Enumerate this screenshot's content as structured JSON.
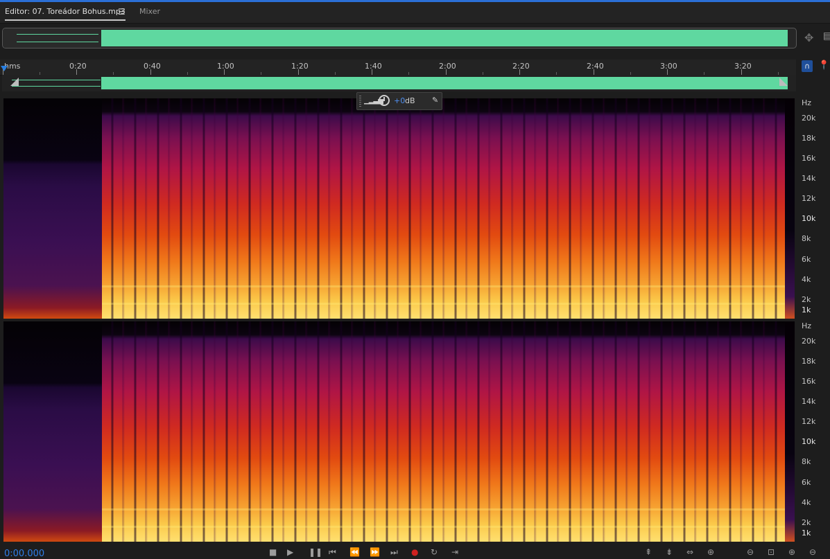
{
  "editor_tab": {
    "title": "Editor: 07. Toreádor Bohus.mp3",
    "menu_glyph": "☰"
  },
  "mixer_tab": {
    "label": "Mixer"
  },
  "ruler": {
    "unit": "hms",
    "labels": [
      "0:20",
      "0:40",
      "1:00",
      "1:20",
      "1:40",
      "2:00",
      "2:20",
      "2:40",
      "3:00",
      "3:20"
    ]
  },
  "hud": {
    "value": "+0",
    "unit": "dB",
    "bars": "▁▂▃▅",
    "pin": "📌"
  },
  "channel1_scale": {
    "unit": "Hz",
    "labels": [
      "20k",
      "18k",
      "16k",
      "14k",
      "12k",
      "10k",
      "8k",
      "6k",
      "4k",
      "2k",
      "1k"
    ]
  },
  "channel2_scale": {
    "unit": "Hz",
    "labels": [
      "20k",
      "18k",
      "16k",
      "14k",
      "12k",
      "10k",
      "8k",
      "6k",
      "4k",
      "2k",
      "1k"
    ]
  },
  "transport": {
    "time": "0:00.000"
  },
  "colors": {
    "accent": "#2b6fd6",
    "waveform": "#5fd8a0",
    "time": "#2f7fe8"
  },
  "icons": [
    "zoom-magnet-icon",
    "snap-icon",
    "marker-pin-icon",
    "knob-icon",
    "pin-icon",
    "play-icon",
    "record-icon"
  ]
}
